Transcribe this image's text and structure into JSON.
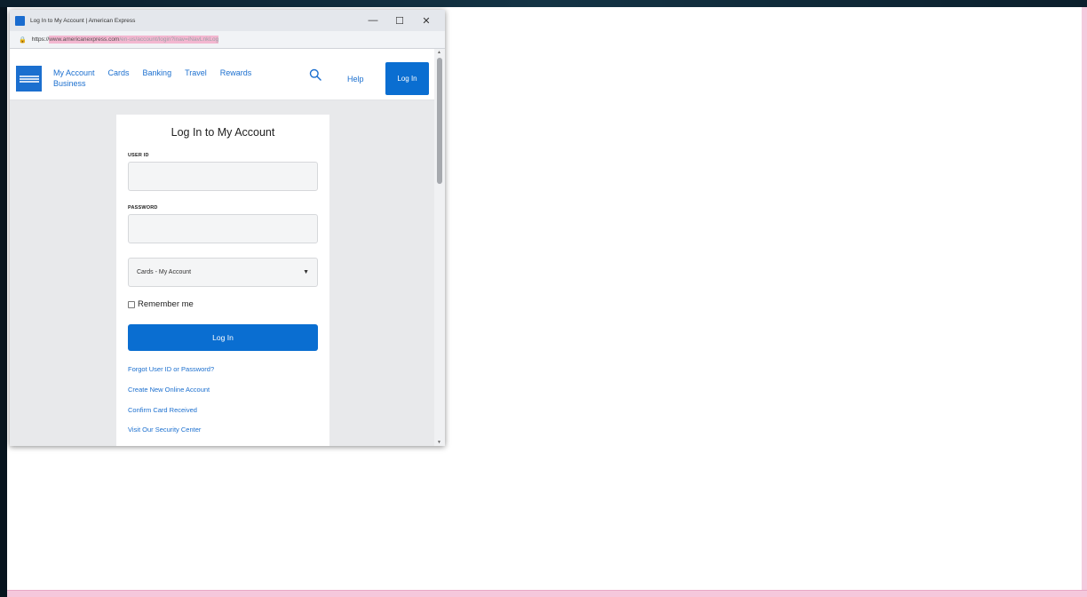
{
  "window": {
    "title": "Log In to My Account | American Express",
    "favicon": "amex-favicon-icon",
    "controls": {
      "minimize": "—",
      "maximize": "☐",
      "close": "✕"
    }
  },
  "address_bar": {
    "scheme": "https://",
    "host_highlighted": "www.americanexpress.com",
    "path_highlighted": "/en-us/account/login?inav=iNavLnkLog",
    "path_rest": ""
  },
  "header": {
    "logo": "amex-logo-icon",
    "nav_row1": [
      "My Account",
      "Cards",
      "Banking",
      "Travel",
      "Rewards"
    ],
    "nav_row2": [
      "Business"
    ],
    "help_label": "Help",
    "login_label": "Log In"
  },
  "form": {
    "title": "Log In to My Account",
    "user_id_label": "USER ID",
    "user_id_value": "",
    "password_label": "PASSWORD",
    "password_value": "",
    "account_select_value": "Cards - My Account",
    "remember_label": "Remember me",
    "remember_checked": false,
    "submit_label": "Log In",
    "links": [
      "Forgot User ID or Password?",
      "Create New Online Account",
      "Confirm Card Received",
      "Visit Our Security Center"
    ]
  },
  "colors": {
    "brand_blue": "#0a6ed1",
    "url_highlight": "#f3b7d0",
    "page_background": "#e8e9eb"
  }
}
